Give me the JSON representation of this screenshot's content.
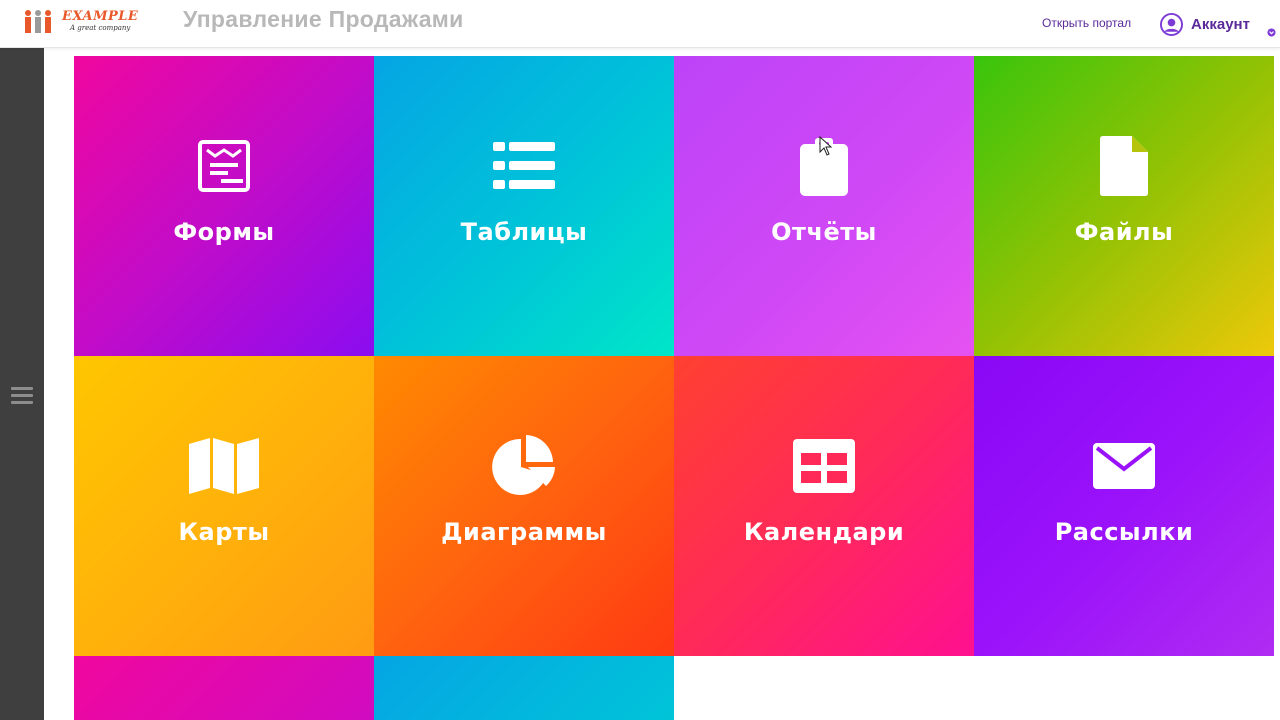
{
  "header": {
    "logo_text": "EXAMPLE",
    "logo_tagline": "A great company",
    "app_title": "Управление Продажами",
    "portal_link": "Открыть портал",
    "account_label": "Аккаунт"
  },
  "sidebar": {
    "menu_icon": "hamburger-icon"
  },
  "tiles": [
    {
      "label": "Формы",
      "icon": "form-icon",
      "color": "#d40bb8"
    },
    {
      "label": "Таблицы",
      "icon": "list-icon",
      "color": "#00c0d8"
    },
    {
      "label": "Отчёты",
      "icon": "clipboard-icon",
      "color": "#cf48f6"
    },
    {
      "label": "Файлы",
      "icon": "file-icon",
      "color": "#92c204"
    },
    {
      "label": "Карты",
      "icon": "map-icon",
      "color": "#ffb20a"
    },
    {
      "label": "Диаграммы",
      "icon": "pie-chart-icon",
      "color": "#ff5f10"
    },
    {
      "label": "Календари",
      "icon": "calendar-icon",
      "color": "#ff2a58"
    },
    {
      "label": "Рассылки",
      "icon": "envelope-icon",
      "color": "#9a12fa"
    },
    {
      "label": "",
      "icon": "",
      "color": "#f0079e"
    },
    {
      "label": "",
      "icon": "",
      "color": "#05a5e4"
    }
  ],
  "colors": {
    "accent": "#5a2a9a",
    "sidebar": "#3f3f3f",
    "title_gray": "#b8b8b8",
    "logo_orange": "#e8582a"
  }
}
